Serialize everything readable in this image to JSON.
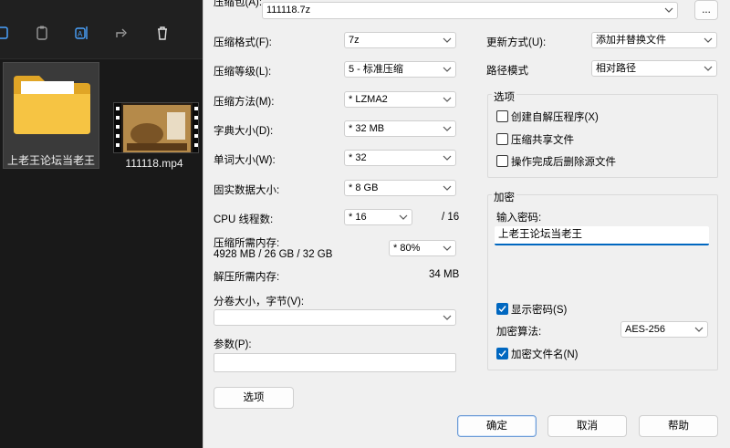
{
  "explorer": {
    "folder_name": "上老王论坛当老王",
    "video_name": "111118.mp4",
    "toolbar_icons": [
      "copy-icon",
      "paste-icon",
      "rename-icon",
      "share-icon",
      "delete-icon"
    ]
  },
  "dialog": {
    "archive_label": "压缩包(A):",
    "archive_value": "111118.7z",
    "browse_label": "...",
    "format_label": "压缩格式(F):",
    "format_value": "7z",
    "level_label": "压缩等级(L):",
    "level_value": "5 - 标准压缩",
    "method_label": "压缩方法(M):",
    "method_value": "* LZMA2",
    "dict_label": "字典大小(D):",
    "dict_value": "* 32 MB",
    "word_label": "单词大小(W):",
    "word_value": "* 32",
    "solid_label": "固实数据大小:",
    "solid_value": "* 8 GB",
    "cpu_label": "CPU 线程数:",
    "cpu_value": "* 16",
    "cpu_total": "/ 16",
    "mem_comp_label": "压缩所需内存:",
    "mem_comp_values": "4928 MB / 26 GB / 32 GB",
    "mem_percent": "* 80%",
    "mem_decomp_label": "解压所需内存:",
    "mem_decomp_value": "34 MB",
    "split_label": "分卷大小，字节(V):",
    "split_value": "",
    "params_label": "参数(P):",
    "params_value": "",
    "options_button": "选项",
    "update_label": "更新方式(U):",
    "update_value": "添加并替换文件",
    "path_label": "路径模式",
    "path_value": "相对路径",
    "options_group": {
      "title": "选项",
      "sfx": "创建自解压程序(X)",
      "shared": "压缩共享文件",
      "delete": "操作完成后删除源文件"
    },
    "encryption": {
      "title": "加密",
      "password_label": "输入密码:",
      "password_value": "上老王论坛当老王",
      "show_password": "显示密码(S)",
      "method_label": "加密算法:",
      "method_value": "AES-256",
      "encrypt_names": "加密文件名(N)"
    },
    "ok": "确定",
    "cancel": "取消",
    "help": "帮助"
  }
}
